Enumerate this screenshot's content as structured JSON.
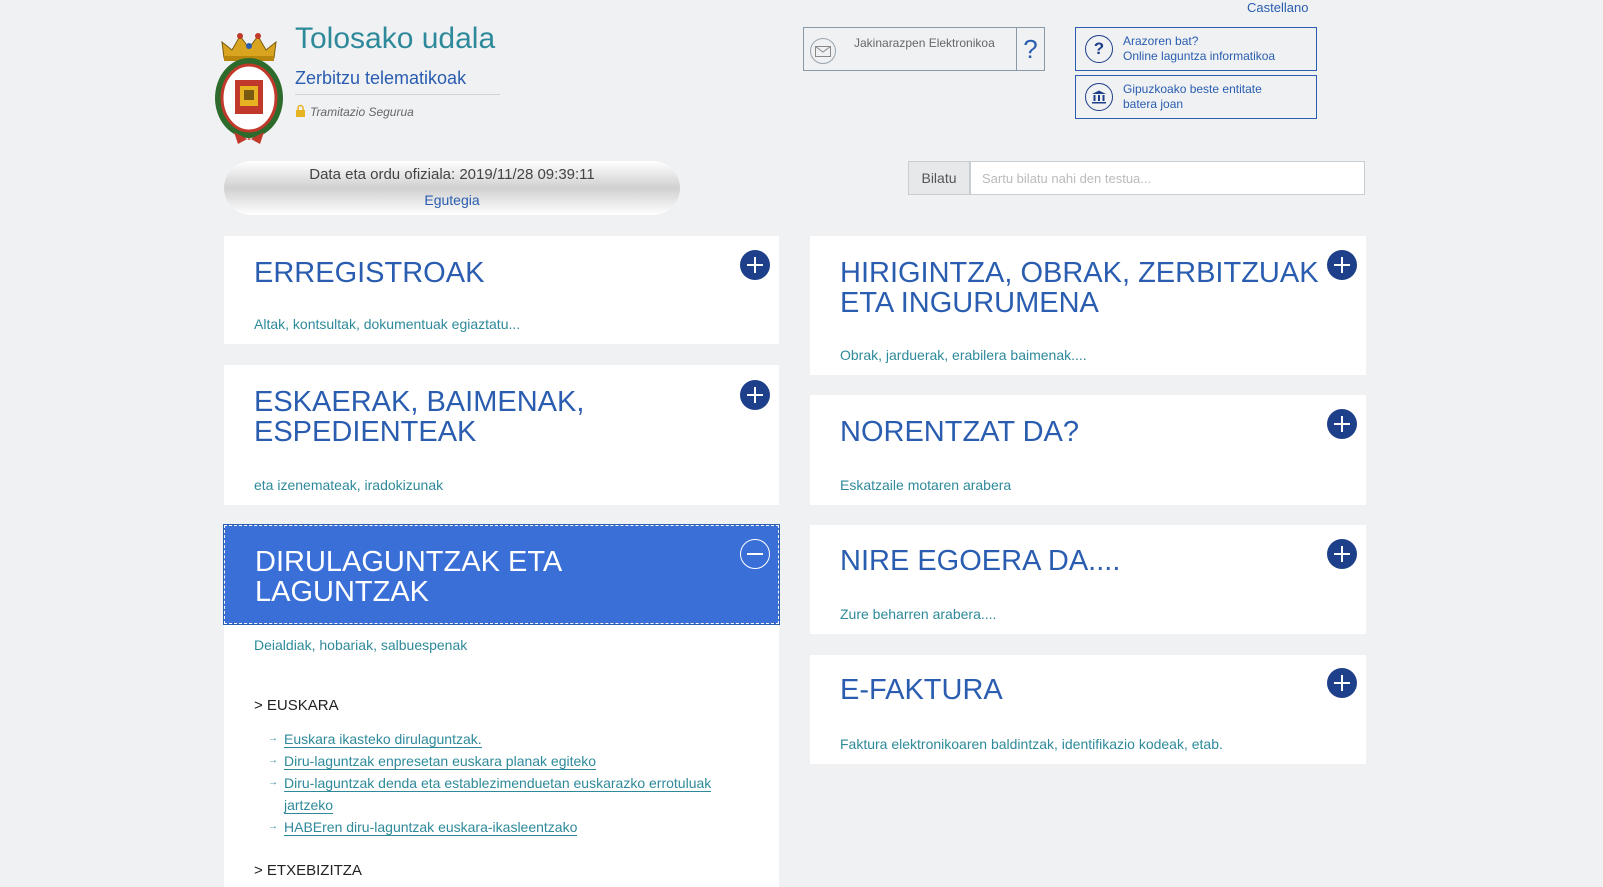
{
  "language_link": "Castellano",
  "header": {
    "title": "Tolosako udala",
    "subtitle": "Zerbitzu telematikoak",
    "secure": "Tramitazio Segurua"
  },
  "notifications": {
    "label": "Jakinarazpen Elektronikoa",
    "help": "?"
  },
  "side_buttons": [
    {
      "line1": "Arazoren bat?",
      "line2": "Online laguntza informatikoa",
      "icon": "question-icon"
    },
    {
      "line1": "Gipuzkoako beste entitate",
      "line2": "batera joan",
      "icon": "bank-icon"
    }
  ],
  "clock": {
    "label": "Data eta ordu ofiziala: 2019/11/28 09:39:11",
    "calendar": "Egutegia"
  },
  "search": {
    "button": "Bilatu",
    "placeholder": "Sartu bilatu nahi den testua..."
  },
  "panels_left": [
    {
      "title": "ERREGISTROAK",
      "desc": "Altak, kontsultak, dokumentuak egiaztatu..."
    },
    {
      "title_1": "ESKAERAK, BAIMENAK,",
      "title_2": "ESPEDIENTEAK",
      "desc": "eta izenemateak, iradokizunak"
    },
    {
      "title_1": "DIRULAGUNTZAK ETA",
      "title_2": "LAGUNTZAK",
      "desc": "Deialdiak, hobariak, salbuespenak"
    }
  ],
  "panels_right": [
    {
      "title_1": "HIRIGINTZA, OBRAK, ZERBITZUAK",
      "title_2": "ETA INGURUMENA",
      "desc": "Obrak, jarduerak, erabilera baimenak...."
    },
    {
      "title": "NORENTZAT DA?",
      "desc": "Eskatzaile motaren arabera"
    },
    {
      "title": "NIRE EGOERA DA....",
      "desc": "Zure beharren arabera...."
    },
    {
      "title": "E-FAKTURA",
      "desc": "Faktura elektronikoaren baldintzak, identifikazio kodeak, etab."
    }
  ],
  "expanded": {
    "group1": "> EUSKARA",
    "links": [
      "Euskara ikasteko dirulaguntzak.",
      "Diru-laguntzak enpresetan euskara planak egiteko",
      "Diru-laguntzak denda eta establezimenduetan euskarazko errotuluak jartzeko",
      "HABEren diru-laguntzak euskara-ikasleentzako"
    ],
    "group2": "> ETXEBIZITZA"
  }
}
